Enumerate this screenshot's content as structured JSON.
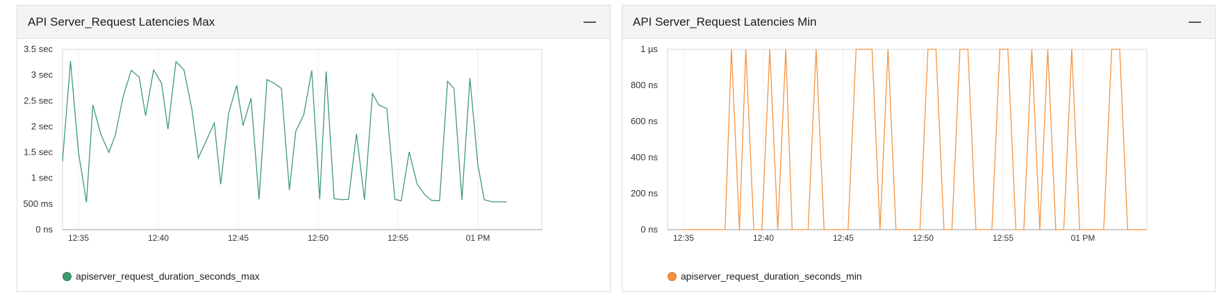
{
  "panels": [
    {
      "title": "API Server_Request Latencies Max",
      "minimize_icon": "minus-icon",
      "legend": "apiserver_request_duration_seconds_max"
    },
    {
      "title": "API Server_Request Latencies Min",
      "minimize_icon": "minus-icon",
      "legend": "apiserver_request_duration_seconds_min"
    }
  ],
  "chart_data": [
    {
      "type": "line",
      "x_unit": "minute of clock time",
      "x_range": [
        "12:34.0",
        "13:04.0"
      ],
      "x_ticks": [
        {
          "t": "12:35",
          "label": "12:35"
        },
        {
          "t": "12:40",
          "label": "12:40"
        },
        {
          "t": "12:45",
          "label": "12:45"
        },
        {
          "t": "12:50",
          "label": "12:50"
        },
        {
          "t": "12:55",
          "label": "12:55"
        },
        {
          "t": "13:00",
          "label": "01 PM"
        }
      ],
      "y_unit": "seconds",
      "ylim": [
        0,
        3.5
      ],
      "y_ticks": [
        {
          "v": 0,
          "label": "0 ns"
        },
        {
          "v": 0.5,
          "label": "500 ms"
        },
        {
          "v": 1,
          "label": "1 sec"
        },
        {
          "v": 1.5,
          "label": "1.5 sec"
        },
        {
          "v": 2,
          "label": "2 sec"
        },
        {
          "v": 2.5,
          "label": "2.5 sec"
        },
        {
          "v": 3,
          "label": "3 sec"
        },
        {
          "v": 3.5,
          "label": "3.5 sec"
        }
      ],
      "grid": "vertical",
      "series": [
        {
          "name": "apiserver_request_duration_seconds_max",
          "color": "#3d9970",
          "points": [
            [
              "12:34.0",
              1.33
            ],
            [
              "12:34.5",
              3.27
            ],
            [
              "12:35.0",
              1.5
            ],
            [
              "12:35.5",
              0.53
            ],
            [
              "12:35.9",
              2.42
            ],
            [
              "12:36.4",
              1.85
            ],
            [
              "12:36.9",
              1.5
            ],
            [
              "12:37.3",
              1.83
            ],
            [
              "12:37.8",
              2.59
            ],
            [
              "12:38.3",
              3.09
            ],
            [
              "12:38.8",
              2.96
            ],
            [
              "12:39.2",
              2.21
            ],
            [
              "12:39.7",
              3.1
            ],
            [
              "12:40.2",
              2.84
            ],
            [
              "12:40.6",
              1.95
            ],
            [
              "12:41.1",
              3.26
            ],
            [
              "12:41.6",
              3.1
            ],
            [
              "12:42.1",
              2.33
            ],
            [
              "12:42.5",
              1.39
            ],
            [
              "12:43.5",
              2.07
            ],
            [
              "12:43.9",
              0.88
            ],
            [
              "12:44.4",
              2.26
            ],
            [
              "12:44.9",
              2.8
            ],
            [
              "12:45.3",
              2.02
            ],
            [
              "12:45.8",
              2.55
            ],
            [
              "12:46.3",
              0.59
            ],
            [
              "12:46.8",
              2.91
            ],
            [
              "12:47.2",
              2.85
            ],
            [
              "12:47.7",
              2.74
            ],
            [
              "12:48.2",
              0.77
            ],
            [
              "12:48.6",
              1.91
            ],
            [
              "12:49.1",
              2.23
            ],
            [
              "12:49.6",
              3.09
            ],
            [
              "12:50.1",
              0.59
            ],
            [
              "12:50.5",
              3.07
            ],
            [
              "12:51.0",
              0.6
            ],
            [
              "12:51.5",
              0.58
            ],
            [
              "12:51.9",
              0.59
            ],
            [
              "12:52.4",
              1.86
            ],
            [
              "12:52.9",
              0.58
            ],
            [
              "12:53.4",
              2.64
            ],
            [
              "12:53.8",
              2.42
            ],
            [
              "12:54.3",
              2.35
            ],
            [
              "12:54.8",
              0.59
            ],
            [
              "12:55.2",
              0.56
            ],
            [
              "12:55.7",
              1.51
            ],
            [
              "12:56.2",
              0.88
            ],
            [
              "12:56.7",
              0.67
            ],
            [
              "12:57.1",
              0.57
            ],
            [
              "12:57.6",
              0.56
            ],
            [
              "12:58.1",
              2.88
            ],
            [
              "12:58.5",
              2.74
            ],
            [
              "12:59.0",
              0.58
            ],
            [
              "12:59.5",
              2.94
            ],
            [
              "13:00.0",
              1.25
            ],
            [
              "13:00.4",
              0.58
            ],
            [
              "13:00.9",
              0.54
            ],
            [
              "13:01.4",
              0.54
            ],
            [
              "13:01.8",
              0.54
            ]
          ]
        }
      ]
    },
    {
      "type": "line",
      "x_unit": "minute of clock time",
      "x_range": [
        "12:34.0",
        "13:04.0"
      ],
      "x_ticks": [
        {
          "t": "12:35",
          "label": "12:35"
        },
        {
          "t": "12:40",
          "label": "12:40"
        },
        {
          "t": "12:45",
          "label": "12:45"
        },
        {
          "t": "12:50",
          "label": "12:50"
        },
        {
          "t": "12:55",
          "label": "12:55"
        },
        {
          "t": "13:00",
          "label": "01 PM"
        }
      ],
      "y_unit": "nanoseconds",
      "ylim": [
        0,
        1000
      ],
      "y_ticks": [
        {
          "v": 0,
          "label": "0 ns"
        },
        {
          "v": 200,
          "label": "200 ns"
        },
        {
          "v": 400,
          "label": "400 ns"
        },
        {
          "v": 600,
          "label": "600 ns"
        },
        {
          "v": 800,
          "label": "800 ns"
        },
        {
          "v": 1000,
          "label": "1 µs"
        }
      ],
      "grid": "vertical",
      "series": [
        {
          "name": "apiserver_request_duration_seconds_min",
          "color": "#f5923e",
          "points": [
            [
              "12:35.0",
              0
            ],
            [
              "12:37.6",
              0
            ],
            [
              "12:38.0",
              1000
            ],
            [
              "12:38.5",
              0
            ],
            [
              "12:38.9",
              1000
            ],
            [
              "12:39.4",
              0
            ],
            [
              "12:39.9",
              0
            ],
            [
              "12:40.4",
              1000
            ],
            [
              "12:40.9",
              0
            ],
            [
              "12:41.4",
              1000
            ],
            [
              "12:41.8",
              0
            ],
            [
              "12:42.3",
              0
            ],
            [
              "12:42.8",
              0
            ],
            [
              "12:43.3",
              1000
            ],
            [
              "12:43.8",
              0
            ],
            [
              "12:44.3",
              0
            ],
            [
              "12:44.8",
              0
            ],
            [
              "12:45.3",
              0
            ],
            [
              "12:45.8",
              1000
            ],
            [
              "12:46.3",
              1000
            ],
            [
              "12:46.8",
              1000
            ],
            [
              "12:47.3",
              0
            ],
            [
              "12:47.8",
              1000
            ],
            [
              "12:48.3",
              0
            ],
            [
              "12:48.8",
              0
            ],
            [
              "12:49.3",
              0
            ],
            [
              "12:49.8",
              0
            ],
            [
              "12:50.3",
              1000
            ],
            [
              "12:50.8",
              1000
            ],
            [
              "12:51.3",
              0
            ],
            [
              "12:51.8",
              0
            ],
            [
              "12:52.3",
              1000
            ],
            [
              "12:52.8",
              1000
            ],
            [
              "12:53.3",
              0
            ],
            [
              "12:53.8",
              0
            ],
            [
              "12:54.3",
              0
            ],
            [
              "12:54.8",
              1000
            ],
            [
              "12:55.3",
              1000
            ],
            [
              "12:55.8",
              0
            ],
            [
              "12:56.3",
              0
            ],
            [
              "12:56.8",
              1000
            ],
            [
              "12:57.3",
              0
            ],
            [
              "12:57.8",
              1000
            ],
            [
              "12:58.3",
              0
            ],
            [
              "12:58.8",
              0
            ],
            [
              "12:59.3",
              1000
            ],
            [
              "12:59.8",
              0
            ],
            [
              "13:00.3",
              0
            ],
            [
              "13:00.8",
              0
            ],
            [
              "13:01.3",
              0
            ],
            [
              "13:01.8",
              1000
            ],
            [
              "13:02.3",
              1000
            ],
            [
              "13:02.8",
              0
            ],
            [
              "13:03.3",
              0
            ],
            [
              "13:04.0",
              0
            ]
          ]
        }
      ]
    }
  ]
}
